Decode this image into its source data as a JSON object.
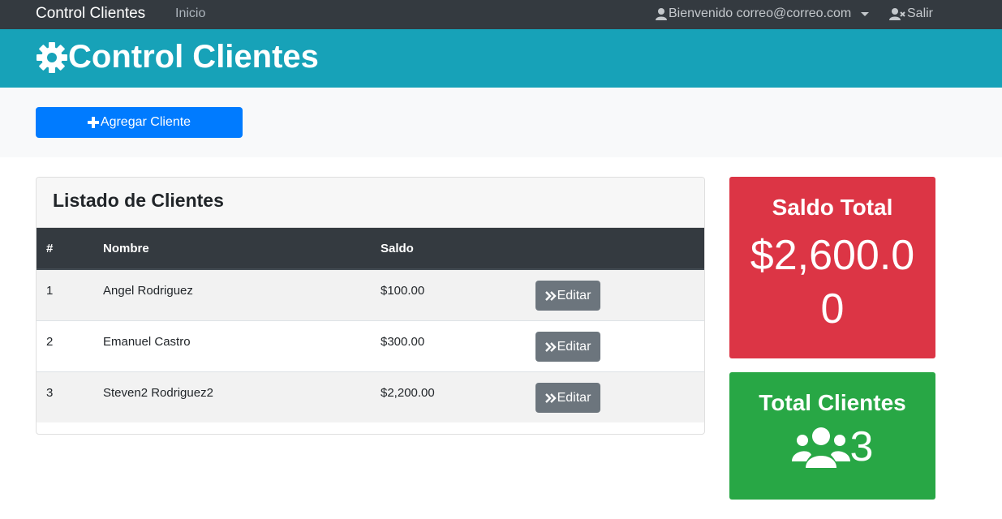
{
  "nav": {
    "brand": "Control Clientes",
    "inicio": "Inicio",
    "user": "Bienvenido correo@correo.com",
    "logout": "Salir"
  },
  "header": {
    "title": "Control Clientes"
  },
  "actions": {
    "add_client": "Agregar Cliente"
  },
  "clients_card": {
    "title": "Listado de Clientes",
    "columns": [
      "#",
      "Nombre",
      "Saldo",
      ""
    ],
    "rows": [
      {
        "num": "1",
        "name": "Angel Rodriguez",
        "saldo": "$100.00",
        "action": "Editar"
      },
      {
        "num": "2",
        "name": "Emanuel Castro",
        "saldo": "$300.00",
        "action": "Editar"
      },
      {
        "num": "3",
        "name": "Steven2 Rodriguez2",
        "saldo": "$2,200.00",
        "action": "Editar"
      }
    ]
  },
  "saldo_card": {
    "label": "Saldo Total",
    "value": "$2,600.00"
  },
  "total_card": {
    "label": "Total Clientes",
    "value": "3"
  },
  "icons": {
    "header": "gear-icon",
    "user": "user-icon",
    "logout": "user-x-icon",
    "add": "plus-icon",
    "edit": "double-chevron-right-icon",
    "clients": "users-icon"
  },
  "colors": {
    "navbar": "#343a40",
    "header": "#17a2b8",
    "primary": "#007bff",
    "secondary": "#6c757d",
    "danger": "#dc3545",
    "success": "#28a745"
  }
}
